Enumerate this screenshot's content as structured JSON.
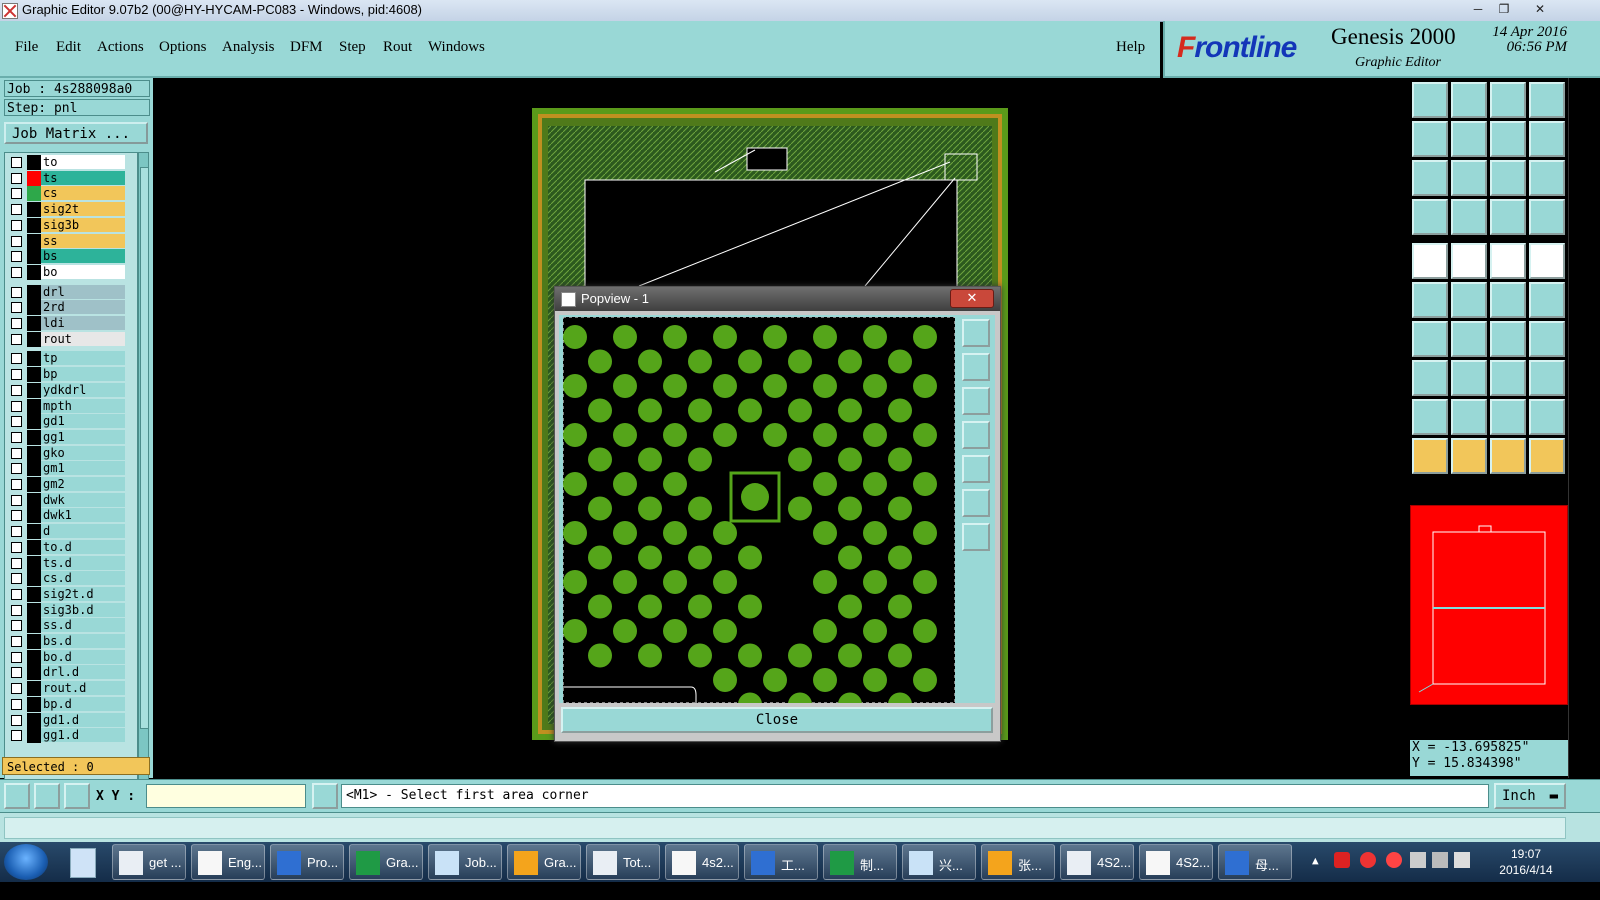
{
  "window": {
    "title": "Graphic Editor 9.07b2 (00@HY-HYCAM-PC083 - Windows, pid:4608)"
  },
  "menu": {
    "items": [
      "File",
      "Edit",
      "Actions",
      "Options",
      "Analysis",
      "DFM",
      "Step",
      "Rout",
      "Windows"
    ],
    "help": "Help"
  },
  "brand": {
    "logo_f": "F",
    "logo_rest": "rontline",
    "product": "Genesis 2000",
    "subtitle": "Graphic Editor",
    "date": "14 Apr 2016",
    "time": "06:56 PM"
  },
  "job": {
    "job_line": "Job : 4s288098a0",
    "step_line": "Step: pnl",
    "matrix_button": "Job Matrix ..."
  },
  "layers": [
    {
      "name": "to",
      "color": "#ffffff",
      "swatch": "#000000"
    },
    {
      "name": "ts",
      "color": "#2db39a",
      "swatch": "#ff0000",
      "active": true
    },
    {
      "name": "cs",
      "color": "#f2c65a",
      "swatch": "#2ea84a"
    },
    {
      "name": "sig2t",
      "color": "#f2c65a",
      "swatch": "#000000"
    },
    {
      "name": "sig3b",
      "color": "#f2c65a",
      "swatch": "#000000"
    },
    {
      "name": "ss",
      "color": "#f2c65a",
      "swatch": "#000000"
    },
    {
      "name": "bs",
      "color": "#2db39a",
      "swatch": "#000000"
    },
    {
      "name": "bo",
      "color": "#ffffff",
      "swatch": "#000000"
    },
    {
      "name": "drl",
      "color": "#9fc1c8",
      "swatch": "#000000"
    },
    {
      "name": "2rd",
      "color": "#9fc1c8",
      "swatch": "#000000"
    },
    {
      "name": "ldi",
      "color": "#9fc1c8",
      "swatch": "#000000"
    },
    {
      "name": "rout",
      "color": "#e7e7e7",
      "swatch": "#000000"
    },
    {
      "name": "tp",
      "color": "#99d8d6",
      "swatch": "#000000"
    },
    {
      "name": "bp",
      "color": "#99d8d6",
      "swatch": "#000000"
    },
    {
      "name": "ydkdrl",
      "color": "#99d8d6",
      "swatch": "#000000"
    },
    {
      "name": "mpth",
      "color": "#99d8d6",
      "swatch": "#000000"
    },
    {
      "name": "gd1",
      "color": "#99d8d6",
      "swatch": "#000000"
    },
    {
      "name": "gg1",
      "color": "#99d8d6",
      "swatch": "#000000"
    },
    {
      "name": "gko",
      "color": "#99d8d6",
      "swatch": "#000000"
    },
    {
      "name": "gm1",
      "color": "#99d8d6",
      "swatch": "#000000"
    },
    {
      "name": "gm2",
      "color": "#99d8d6",
      "swatch": "#000000"
    },
    {
      "name": "dwk",
      "color": "#99d8d6",
      "swatch": "#000000"
    },
    {
      "name": "dwk1",
      "color": "#99d8d6",
      "swatch": "#000000"
    },
    {
      "name": "d",
      "color": "#99d8d6",
      "swatch": "#000000"
    },
    {
      "name": "to.d",
      "color": "#99d8d6",
      "swatch": "#000000"
    },
    {
      "name": "ts.d",
      "color": "#99d8d6",
      "swatch": "#000000"
    },
    {
      "name": "cs.d",
      "color": "#99d8d6",
      "swatch": "#000000"
    },
    {
      "name": "sig2t.d",
      "color": "#99d8d6",
      "swatch": "#000000"
    },
    {
      "name": "sig3b.d",
      "color": "#99d8d6",
      "swatch": "#000000"
    },
    {
      "name": "ss.d",
      "color": "#99d8d6",
      "swatch": "#000000"
    },
    {
      "name": "bs.d",
      "color": "#99d8d6",
      "swatch": "#000000"
    },
    {
      "name": "bo.d",
      "color": "#99d8d6",
      "swatch": "#000000"
    },
    {
      "name": "drl.d",
      "color": "#99d8d6",
      "swatch": "#000000"
    },
    {
      "name": "rout.d",
      "color": "#99d8d6",
      "swatch": "#000000"
    },
    {
      "name": "bp.d",
      "color": "#99d8d6",
      "swatch": "#000000"
    },
    {
      "name": "gd1.d",
      "color": "#99d8d6",
      "swatch": "#000000"
    },
    {
      "name": "gg1.d",
      "color": "#99d8d6",
      "swatch": "#000000"
    }
  ],
  "selected": "Selected : 0",
  "popview": {
    "title": "Popview - 1",
    "close_x": "✕",
    "close_button": "Close"
  },
  "coords": {
    "x": "X = -13.695825\"",
    "y": "Y = 15.834398\""
  },
  "command": {
    "xy_label": "X Y :",
    "xy_value": "",
    "message": "<M1> - Select first area corner",
    "unit": "Inch"
  },
  "taskbar": {
    "items": [
      {
        "label": "get ...",
        "icon": "browser-icon"
      },
      {
        "label": "Eng...",
        "icon": "genesis-icon"
      },
      {
        "label": "Pro...",
        "icon": "genesis-icon"
      },
      {
        "label": "Gra...",
        "icon": "genesis-icon"
      },
      {
        "label": "Job...",
        "icon": "genesis-icon"
      },
      {
        "label": "Gra...",
        "icon": "genesis-icon"
      },
      {
        "label": "Tot...",
        "icon": "save-disk-icon"
      },
      {
        "label": "4s2...",
        "icon": "document-icon"
      },
      {
        "label": "工...",
        "icon": "app-f-icon"
      },
      {
        "label": "制...",
        "icon": "notepad-icon"
      },
      {
        "label": "兴...",
        "icon": "shell-icon"
      },
      {
        "label": "张...",
        "icon": "frontline-icon"
      },
      {
        "label": "4S2...",
        "icon": "excel-icon"
      },
      {
        "label": "4S2...",
        "icon": "excel-icon"
      },
      {
        "label": "母...",
        "icon": "app-icon"
      }
    ],
    "time": "19:07",
    "date": "2016/4/14"
  }
}
